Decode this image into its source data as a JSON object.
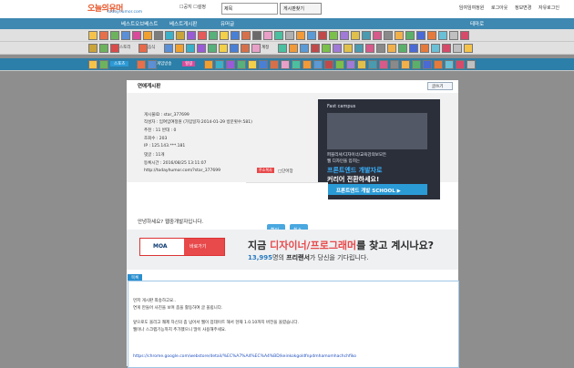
{
  "site": {
    "logo_top": "오늘의유머",
    "logo_sub": "todayhumor.com"
  },
  "top": {
    "field_label": "☐공지 ☐설정",
    "select_value": "제목",
    "search_button": "게시판찾기",
    "links": [
      "임여임여정원",
      "로그아웃",
      "정보변경",
      "자유로그인"
    ]
  },
  "nav": {
    "items": [
      "베스트오브베스트",
      "베스트게시판",
      "유머글"
    ],
    "right": "테마로"
  },
  "iconrows": {
    "row2_labels": [
      "스토리",
      "음식",
      "계정"
    ],
    "row3_labels": [
      "스포츠",
      "게임방송",
      "힐링"
    ]
  },
  "panel": {
    "title": "연애게시판",
    "button": "글쓰기",
    "info": [
      "게시물ID : star_377699",
      "작성자 : 임여임여정원 (가입일자:2014-01-29 방문횟수:581)",
      "추천 : 11      반대 : 0",
      "조회수 : 203",
      "IP : 125.143.***.181",
      "댓글 : 11개",
      "등록시간 : 2016/08/25 13:11:07",
      "http://todayhumor.com/?star_377699"
    ],
    "recommend_label": "주소복사",
    "share_label": "□단어장"
  },
  "ad": {
    "brand": "Fast campus",
    "line1": "퍼블리셔/디자이너/교육강의보모든",
    "line2": "웹 디자인을 입히는",
    "line3": "프론트엔드 개발자로",
    "line4": "커리어 전환하세요!",
    "button": "프론트엔드 개발 SCHOOL  ▶"
  },
  "dialog": {
    "ok": "확인",
    "cancel": "취소"
  },
  "post": {
    "greeting": "안녕하세요? 웹중개발자입니다."
  },
  "banner": {
    "logo": "MOA",
    "red_label": "바로가기",
    "headline_prefix": "지금 ",
    "headline_red": "디자이너/프로그래머",
    "headline_suffix": "를 찾고 계시나요?",
    "sub_count": "13,995",
    "sub_prefix": "명의 ",
    "sub_bold": "프리랜서",
    "sub_suffix": "가 당신을 기다립니다."
  },
  "content": {
    "tag": "목록",
    "lines": [
      "먼저 게시판 죄송하고요..",
      "연게 만들어 사진을 보며 좀을 활동하여 글 올립니다.",
      "",
      "앞으로도 올리고 쾌제 자신의 좀 넘어서 웹이 업데이트 해서 현재 1.0.10까지 버전을 올렸습니다.",
      "웹이나 스크랩기능까지 추가했으니 많이 사용해주세요.",
      ""
    ],
    "url": "https://chrome.google.com/webstore/detail/%EC%A7%A4%EC%A4%BD/keinkokgoldfnpdmhamomhachchfiko"
  },
  "colors": {
    "nav": "#3e88b2",
    "accent": "#2a8fcf",
    "red": "#e8494b"
  }
}
